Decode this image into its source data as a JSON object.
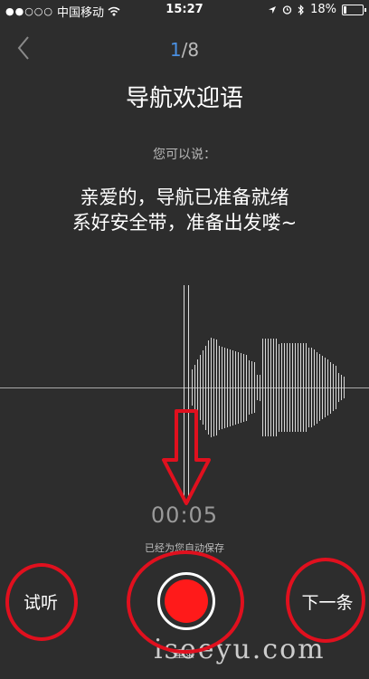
{
  "status_bar": {
    "signal_dots": "●●○○○",
    "carrier": "中国移动",
    "time": "15:27",
    "battery": "18%",
    "battery_level": 0.18
  },
  "header": {
    "current_page": "1",
    "total_pages": "/8",
    "title": "导航欢迎语"
  },
  "prompt": {
    "label": "您可以说：",
    "line1": "亲爱的，导航已准备就绪",
    "line2": "系好安全带，准备出发喽~"
  },
  "recorder": {
    "elapsed": "00:05",
    "saved_note": "已经为您自动保存",
    "rerecord_label": "重录",
    "audition_label": "试听",
    "next_label": "下一条"
  },
  "watermark": "iseeyu.com",
  "colors": {
    "background": "#2d2d2d",
    "accent": "#4a90e2",
    "record": "#ff1a1a",
    "annotation": "#e0101e"
  },
  "icons": [
    "wifi-icon",
    "back-chevron-icon",
    "location-arrow-icon",
    "alarm-icon",
    "bluetooth-icon",
    "battery-icon"
  ]
}
